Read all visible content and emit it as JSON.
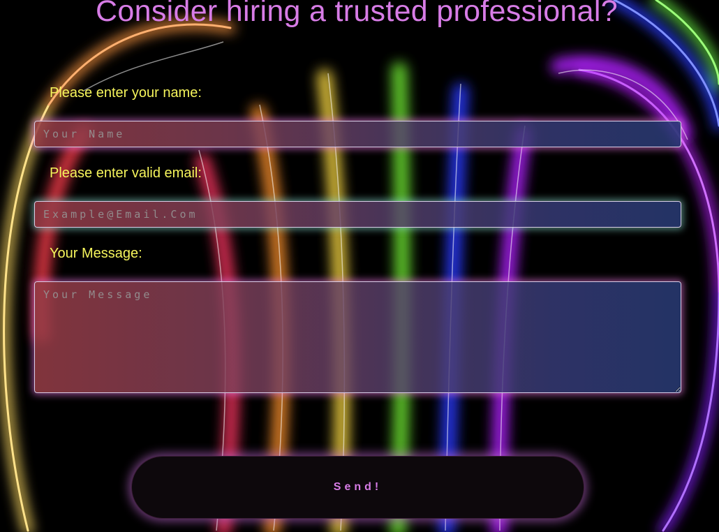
{
  "page": {
    "title": "Consider hiring a trusted professional?"
  },
  "form": {
    "name_label": "Please enter your name:",
    "name_placeholder": "Your Name",
    "email_label": "Please enter valid email:",
    "email_placeholder": "Example@Email.Com",
    "message_label": "Your Message:",
    "message_placeholder": "Your Message",
    "send_label": "Send!"
  },
  "colors": {
    "title": "#d77ce6",
    "labels": "#f6f55c",
    "button_text": "#d77ce6",
    "background": "#000000"
  },
  "icons": {
    "background": "neon-rainbow-arcs-decoration"
  }
}
